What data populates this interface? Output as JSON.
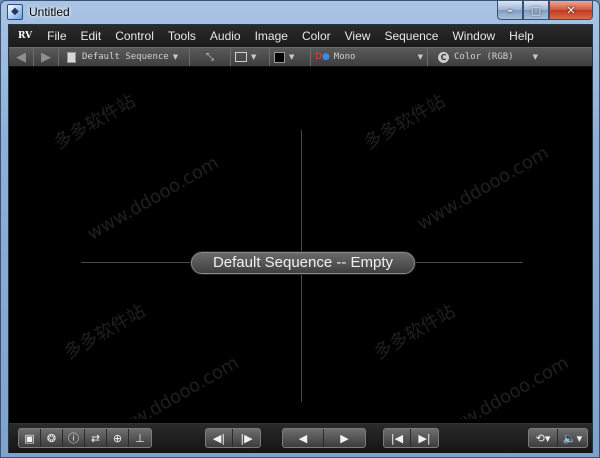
{
  "window": {
    "title": "Untitled",
    "app_icon": "rv-app-icon",
    "caption_buttons": [
      "minimize",
      "maximize",
      "close"
    ]
  },
  "menubar": {
    "logo": "RV",
    "items": [
      "File",
      "Edit",
      "Control",
      "Tools",
      "Audio",
      "Image",
      "Color",
      "View",
      "Sequence",
      "Window",
      "Help"
    ]
  },
  "toolbar": {
    "back_icon": "arrow-left-icon",
    "forward_icon": "arrow-right-icon",
    "sequence_menu": "Default Sequence",
    "stereo_menu": "Mono",
    "color_menu": "Color (RGB)"
  },
  "viewer": {
    "label": "Default Sequence -- Empty",
    "watermark": "www.ddooo.com",
    "watermark_cn": "多多软件站"
  },
  "bottombar": {
    "left_icons": [
      "session-manager-icon",
      "network-icon",
      "info-icon",
      "swap-icon",
      "ghost-icon",
      "timeline-icon"
    ],
    "step_icons": [
      "step-back-icon",
      "step-forward-icon"
    ],
    "play_icons": [
      "play-reverse-icon",
      "play-forward-icon"
    ],
    "jump_icons": [
      "jump-start-icon",
      "jump-end-icon"
    ],
    "right_icons": [
      "loop-icon",
      "volume-icon"
    ]
  },
  "colors": {
    "viewer_bg": "#000000",
    "menubar_bg": "#1f1f1f",
    "accent": "#6d8fb5"
  }
}
